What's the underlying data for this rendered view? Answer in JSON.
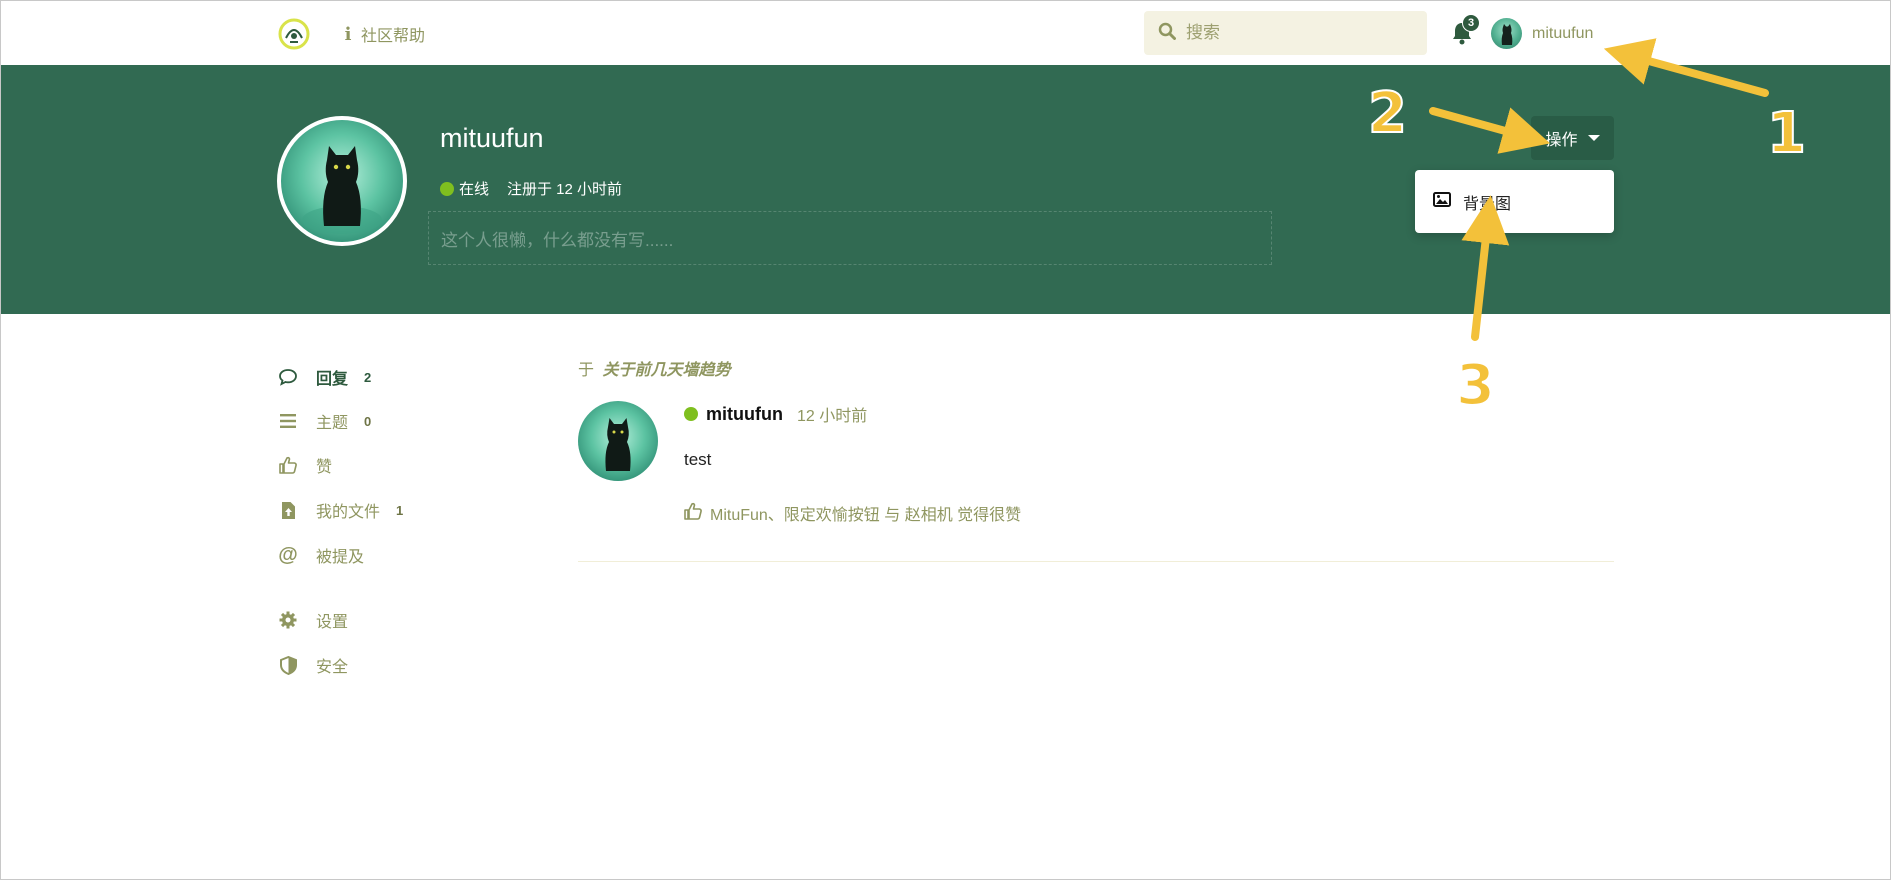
{
  "header": {
    "help_label": "社区帮助",
    "search_placeholder": "搜索",
    "notification_count": "3",
    "username": "mituufun"
  },
  "profile": {
    "name": "mituufun",
    "status": "在线",
    "registered": "注册于 12 小时前",
    "bio_placeholder": "这个人很懒，什么都没有写......",
    "ops_label": "操作",
    "dropdown": {
      "background_label": "背景图"
    }
  },
  "nav": {
    "items": [
      {
        "label": "回复",
        "count": "2",
        "icon": "chat-bubble-icon"
      },
      {
        "label": "主题",
        "count": "0",
        "icon": "list-icon"
      },
      {
        "label": "赞",
        "count": "",
        "icon": "thumbs-up-icon"
      },
      {
        "label": "我的文件",
        "count": "1",
        "icon": "file-upload-icon"
      },
      {
        "label": "被提及",
        "count": "",
        "icon": "at-icon"
      },
      {
        "label": "设置",
        "count": "",
        "icon": "gear-icon"
      },
      {
        "label": "安全",
        "count": "",
        "icon": "shield-icon"
      }
    ]
  },
  "post": {
    "context_prefix": "于",
    "context_title": "关于前几天墙趋势",
    "author": "mituufun",
    "time": "12 小时前",
    "body": "test",
    "likes": "MituFun、限定欢愉按钮 与 赵相机 觉得很赞"
  },
  "annotations": [
    "1",
    "2",
    "3"
  ],
  "colors": {
    "brand_green": "#316a52",
    "accent_olive": "#8f9660",
    "online": "#7fbf1f",
    "annotation_yellow": "#f3c13a"
  }
}
